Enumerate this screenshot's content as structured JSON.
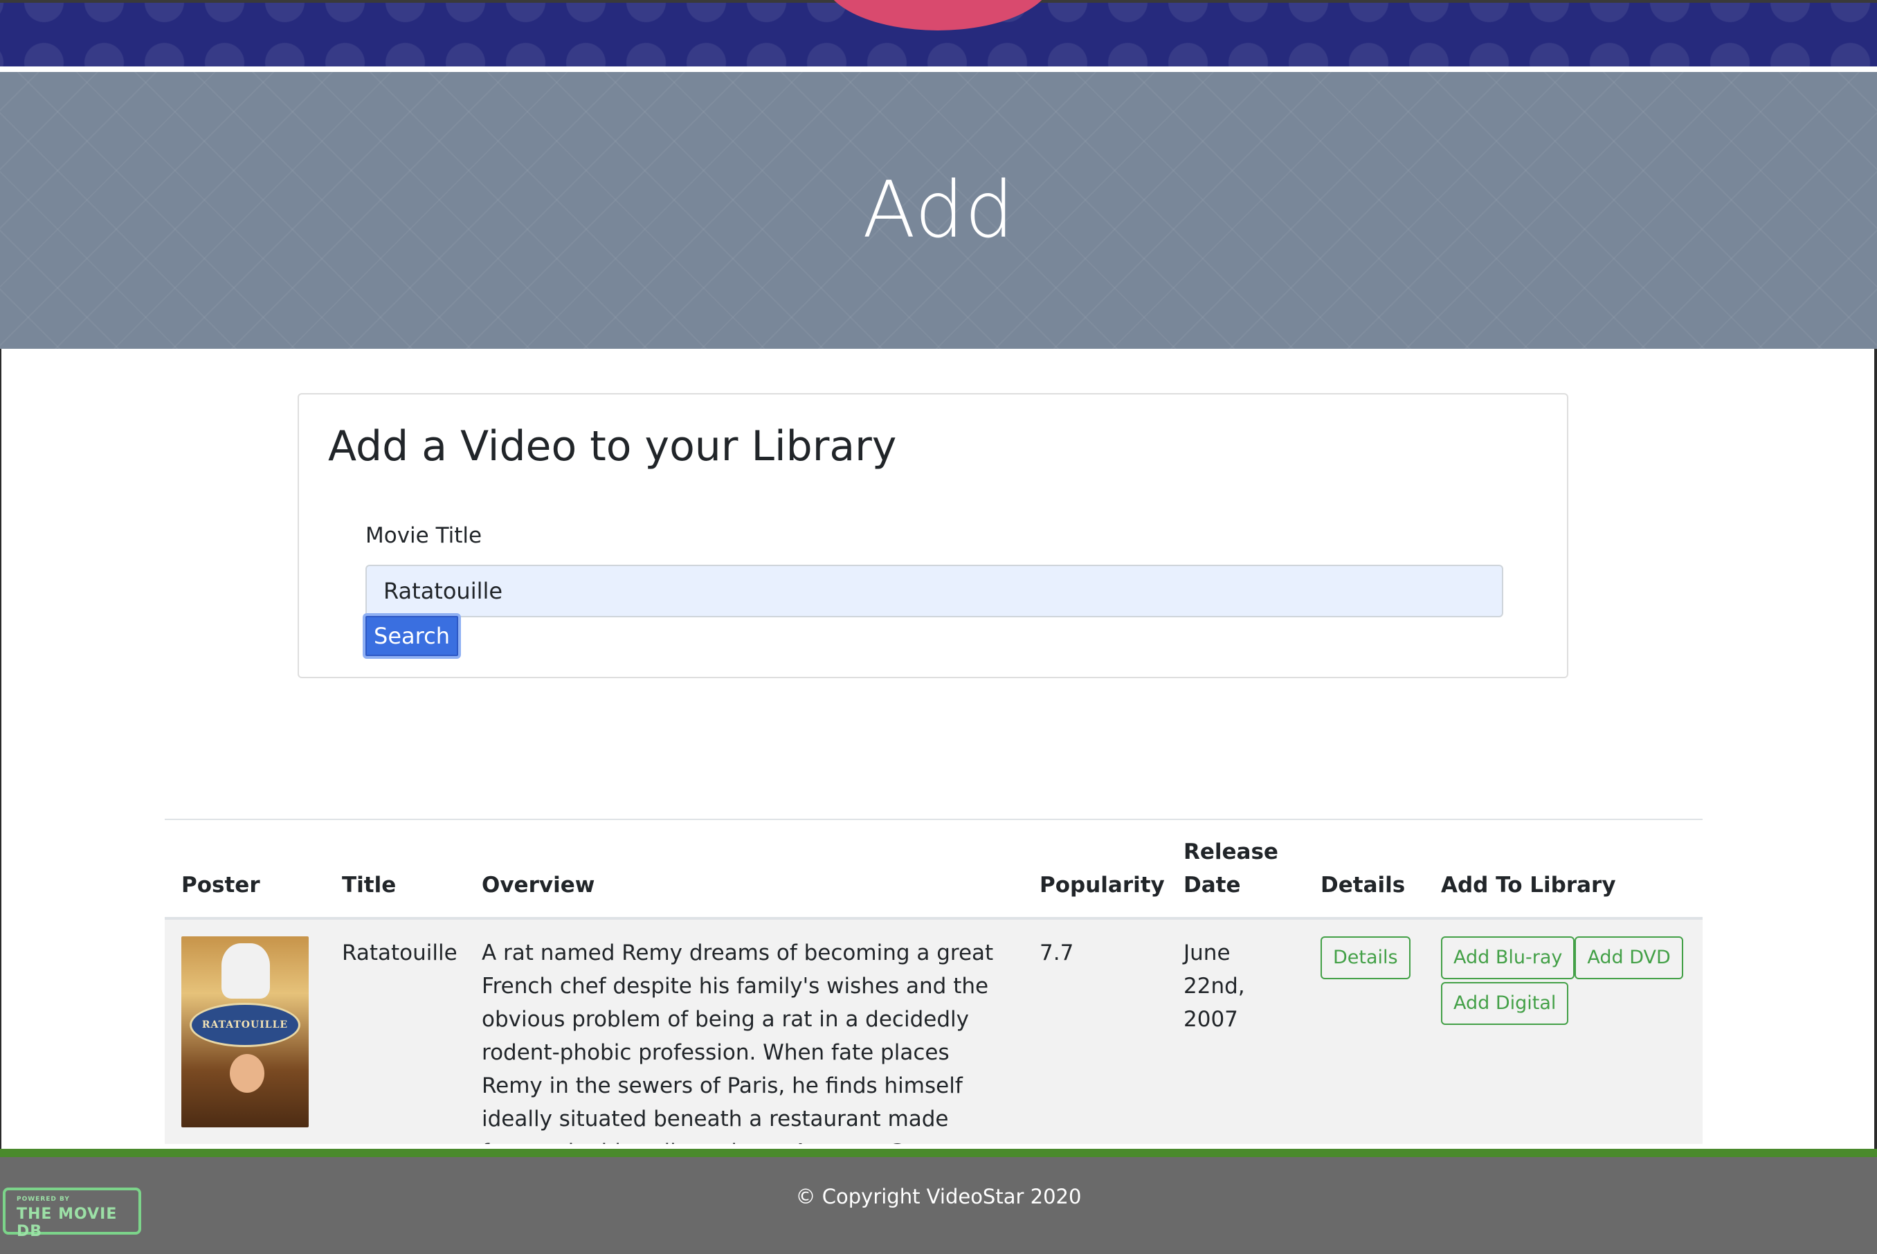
{
  "hero": {
    "title": "Add"
  },
  "search_card": {
    "heading": "Add a Video to your Library",
    "field_label": "Movie Title",
    "input_value": "Ratatouille",
    "search_label": "Search"
  },
  "results": {
    "headers": {
      "poster": "Poster",
      "title": "Title",
      "overview": "Overview",
      "popularity": "Popularity",
      "release_date_line1": "Release",
      "release_date_line2": "Date",
      "details": "Details",
      "add_to_library": "Add To Library"
    },
    "rows": [
      {
        "poster_text": "RATATOUILLE",
        "title": "Ratatouille",
        "overview": "A rat named Remy dreams of becoming a great French chef despite his family's wishes and the obvious problem of being a rat in a decidedly rodent-phobic profession. When fate places Remy in the sewers of Paris, he finds himself ideally situated beneath a restaurant made famous by his culinary hero, Auguste Gusteau. Despite the",
        "popularity": "7.7",
        "release_date_line1": "June",
        "release_date_line2": "22nd,",
        "release_date_line3": "2007",
        "details_label": "Details",
        "add_bluray_label": "Add Blu-ray",
        "add_dvd_label": "Add DVD",
        "add_digital_label": "Add Digital"
      }
    ]
  },
  "footer": {
    "copyright": "© Copyright VideoStar 2020",
    "tmdb_small": "POWERED BY",
    "tmdb_big": "THE MOVIE DB"
  },
  "colors": {
    "top_band": "#262a7d",
    "hero_bg": "#798799",
    "search_button": "#3a6fe0",
    "success_outline": "#43a047",
    "footer_bg": "#6a6a6a",
    "footer_border": "#4a8a2c"
  },
  "icons": {
    "brand_logo": "brand-logo-circle",
    "tmdb_logo": "tmdb-logo"
  }
}
